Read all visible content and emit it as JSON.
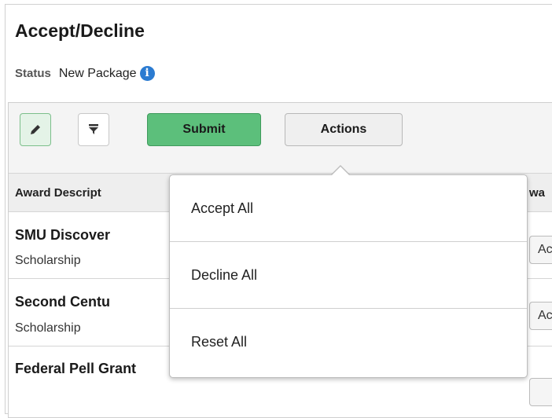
{
  "page": {
    "title": "Accept/Decline",
    "status_label": "Status",
    "status_value": "New Package"
  },
  "toolbar": {
    "submit_label": "Submit",
    "actions_label": "Actions"
  },
  "table": {
    "columns": [
      "Award Descript",
      "wa"
    ],
    "rows": [
      {
        "name": "SMU Discover",
        "type": "Scholarship",
        "action": "Acc"
      },
      {
        "name": "Second Centu",
        "type": "Scholarship",
        "action": "Acc"
      },
      {
        "name": "Federal Pell Grant",
        "type": "",
        "action": ""
      }
    ]
  },
  "actions_menu": {
    "items": [
      {
        "label": "Accept All"
      },
      {
        "label": "Decline All"
      },
      {
        "label": "Reset All"
      }
    ]
  },
  "colors": {
    "submit": "#5cbf7b",
    "edit_active": "#e4f3e7",
    "info": "#2b7bd1"
  }
}
